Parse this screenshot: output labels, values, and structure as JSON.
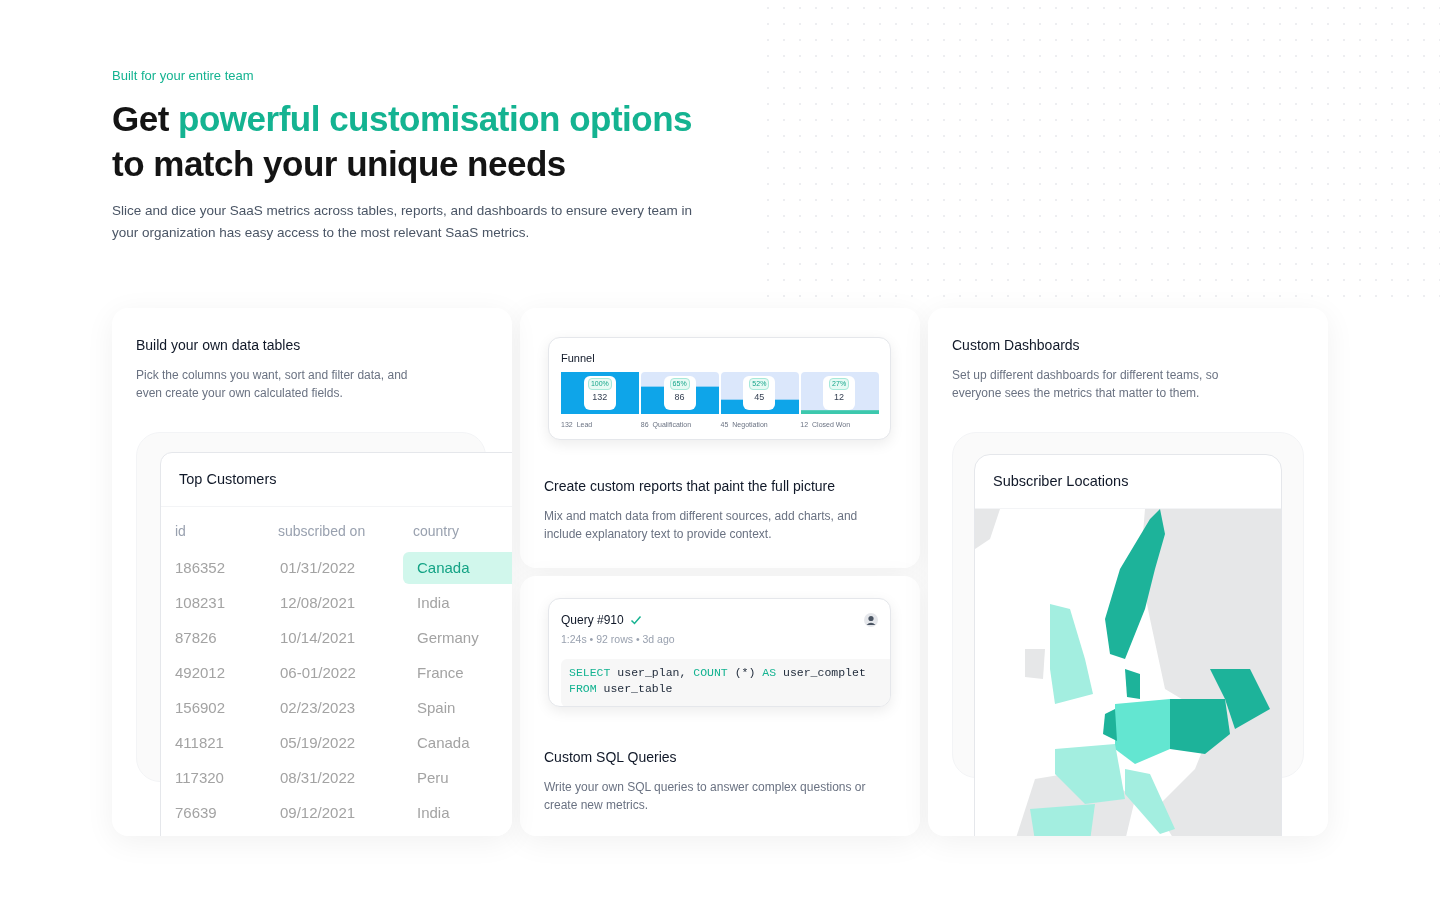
{
  "eyebrow": "Built for your entire team",
  "heading": {
    "plain_start": "Get",
    "highlight": "powerful customisation options",
    "line2": "to match your unique needs"
  },
  "intro": "Slice and dice your SaaS metrics across tables, reports, and dashboards to ensure every team in your organization has easy access to the most relevant SaaS metrics.",
  "tables_card": {
    "title": "Build your own data tables",
    "description": "Pick the columns you want, sort and filter data, and even create your own calculated fields.",
    "table": {
      "title": "Top Customers",
      "columns": [
        "id",
        "subscribed on",
        "country"
      ],
      "rows": [
        {
          "cells": [
            "186352",
            "01/31/2022",
            "Canada"
          ],
          "selected": true
        },
        {
          "cells": [
            "108231",
            "12/08/2021",
            "India"
          ],
          "selected": false
        },
        {
          "cells": [
            "87826",
            "10/14/2021",
            "Germany"
          ],
          "selected": false
        },
        {
          "cells": [
            "492012",
            "06-01/2022",
            "France"
          ],
          "selected": false
        },
        {
          "cells": [
            "156902",
            "02/23/2023",
            "Spain"
          ],
          "selected": false
        },
        {
          "cells": [
            "411821",
            "05/19/2022",
            "Canada"
          ],
          "selected": false
        },
        {
          "cells": [
            "117320",
            "08/31/2022",
            "Peru"
          ],
          "selected": false
        },
        {
          "cells": [
            "76639",
            "09/12/2021",
            "India"
          ],
          "selected": false
        }
      ]
    }
  },
  "reports_card": {
    "title": "Create custom reports that paint the full picture",
    "description": "Mix and match data from different sources, add charts, and include explanatory text to provide context.",
    "funnel": {
      "title": "Funnel",
      "stages": [
        {
          "percent": "100%",
          "value": "132",
          "count": "132",
          "color": "#0ea5e9"
        },
        {
          "percent": "65%",
          "value": "86",
          "count": "86",
          "color": "#0ea5e9"
        },
        {
          "percent": "52%",
          "value": "45",
          "count": "45",
          "color": "#0ea5e9"
        },
        {
          "percent": "27%",
          "value": "12",
          "count": "12",
          "color": "#3cc8ad"
        }
      ],
      "chart_data": {
        "type": "bar",
        "categories": [
          "Lead",
          "Qualification",
          "Negotiation",
          "Closed Won"
        ],
        "values": [
          132,
          86,
          45,
          12
        ],
        "data_labels": true
      }
    }
  },
  "sql_card": {
    "title": "Custom SQL Queries",
    "description": "Write your own SQL queries to answer complex questions or create new metrics.",
    "query": {
      "title": "Query #910",
      "success": true,
      "meta": "1:24s • 92 rows • 3d ago",
      "code": [
        [
          {
            "t": "SELECT",
            "kw": true
          },
          {
            "t": " user_plan, ",
            "kw": false
          },
          {
            "t": "COUNT",
            "kw": true
          },
          {
            "t": " (*) ",
            "kw": false
          },
          {
            "t": "AS",
            "kw": true
          },
          {
            "t": " user_complet",
            "kw": false
          }
        ],
        [
          {
            "t": "FROM",
            "kw": true
          },
          {
            "t": " user_table",
            "kw": false
          }
        ]
      ]
    }
  },
  "dashboards_card": {
    "title": "Custom Dashboards",
    "description": "Set up different dashboards for different teams, so everyone sees the metrics that matter to them.",
    "map_title": "Subscriber Locations"
  }
}
